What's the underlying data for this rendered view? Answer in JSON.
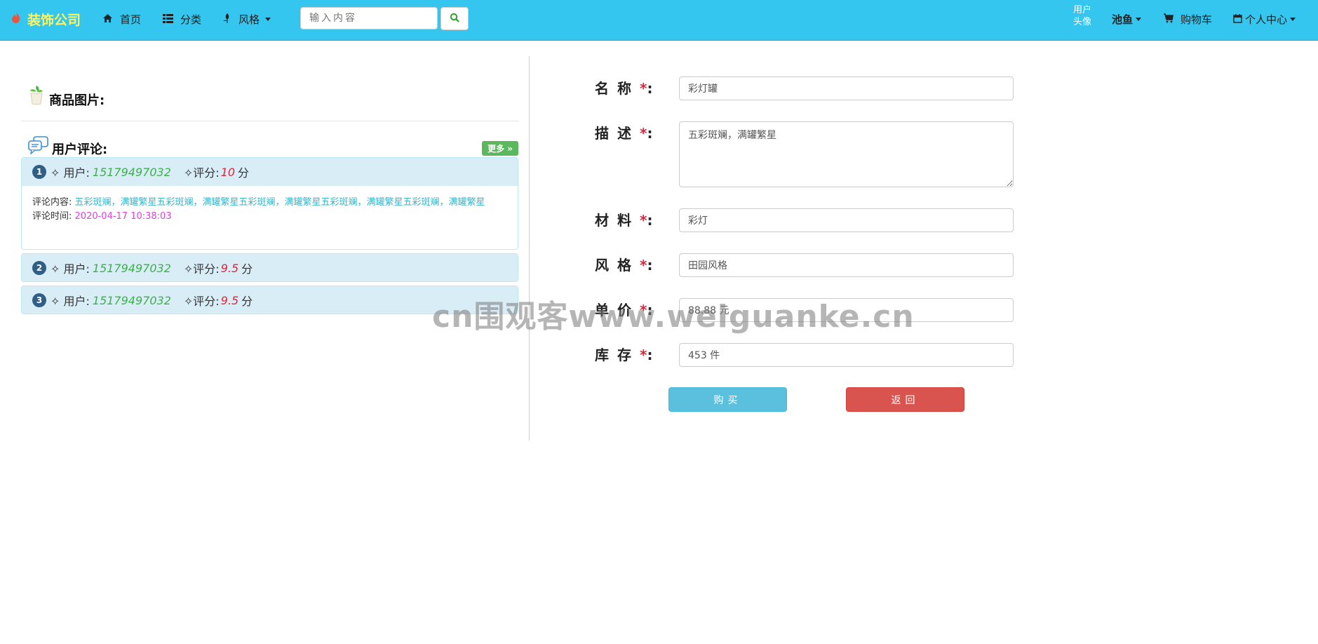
{
  "navbar": {
    "brand": "装饰公司",
    "items": [
      {
        "label": "首页",
        "icon": "home-icon"
      },
      {
        "label": "分类",
        "icon": "list-icon"
      },
      {
        "label": "风格",
        "icon": "leaf-icon"
      }
    ],
    "search_placeholder": "输入内容",
    "avatar_alt": "用户头像",
    "username": "池鱼",
    "cart": "购物车",
    "personal_center": "个人中心"
  },
  "left": {
    "product_images_title": "商品图片:",
    "comments_title": "用户评论:",
    "more_button": "更多 »",
    "user_label": "✧ 用户:",
    "score_label": "✧评分:",
    "score_unit": "分",
    "content_label": "评论内容:",
    "time_label": "评论时间:",
    "comments": [
      {
        "index": "1",
        "user": "15179497032",
        "score": "10",
        "content": "五彩斑斓，满罐繁星五彩斑斓，满罐繁星五彩斑斓，满罐繁星五彩斑斓，满罐繁星五彩斑斓，满罐繁星",
        "time": "2020-04-17 10:38:03"
      },
      {
        "index": "2",
        "user": "15179497032",
        "score": "9.5"
      },
      {
        "index": "3",
        "user": "15179497032",
        "score": "9.5"
      }
    ]
  },
  "form": {
    "name_label": "名称",
    "name_value": "彩灯罐",
    "desc_label": "描述",
    "desc_value": "五彩斑斓，满罐繁星",
    "material_label": "材料",
    "material_value": "彩灯",
    "style_label": "风格",
    "style_value": "田园风格",
    "price_label": "单价",
    "price_value": "88.88 元",
    "stock_label": "库存",
    "stock_value": "453 件",
    "required_mark": "*",
    "colon": ":",
    "buy_button": "购买",
    "back_button": "返回"
  },
  "watermark": "cn围观客www.weiguanke.cn",
  "colors": {
    "navbar": "#35c6ef",
    "brand": "#fff45a",
    "buy": "#5bc0de",
    "back": "#d9534f",
    "more": "#5cb85c",
    "comment_head": "#d9edf7"
  }
}
